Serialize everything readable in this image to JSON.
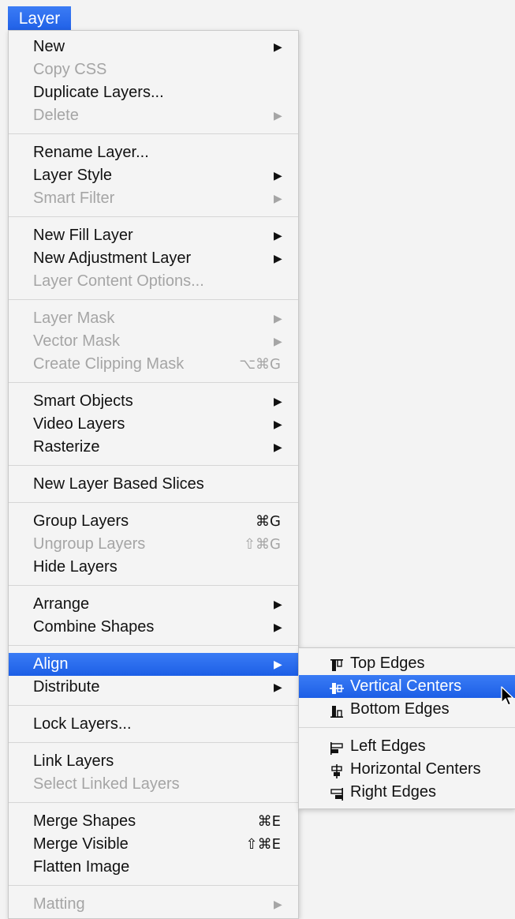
{
  "menubar": {
    "title": "Layer"
  },
  "menu": {
    "groups": [
      [
        {
          "label": "New",
          "submenu": true
        },
        {
          "label": "Copy CSS",
          "disabled": true
        },
        {
          "label": "Duplicate Layers..."
        },
        {
          "label": "Delete",
          "submenu": true,
          "disabled": true
        }
      ],
      [
        {
          "label": "Rename Layer..."
        },
        {
          "label": "Layer Style",
          "submenu": true
        },
        {
          "label": "Smart Filter",
          "submenu": true,
          "disabled": true
        }
      ],
      [
        {
          "label": "New Fill Layer",
          "submenu": true
        },
        {
          "label": "New Adjustment Layer",
          "submenu": true
        },
        {
          "label": "Layer Content Options...",
          "disabled": true
        }
      ],
      [
        {
          "label": "Layer Mask",
          "submenu": true,
          "disabled": true
        },
        {
          "label": "Vector Mask",
          "submenu": true,
          "disabled": true
        },
        {
          "label": "Create Clipping Mask",
          "shortcut": "⌥⌘G",
          "disabled": true
        }
      ],
      [
        {
          "label": "Smart Objects",
          "submenu": true
        },
        {
          "label": "Video Layers",
          "submenu": true
        },
        {
          "label": "Rasterize",
          "submenu": true
        }
      ],
      [
        {
          "label": "New Layer Based Slices"
        }
      ],
      [
        {
          "label": "Group Layers",
          "shortcut": "⌘G"
        },
        {
          "label": "Ungroup Layers",
          "shortcut": "⇧⌘G",
          "disabled": true
        },
        {
          "label": "Hide Layers"
        }
      ],
      [
        {
          "label": "Arrange",
          "submenu": true
        },
        {
          "label": "Combine Shapes",
          "submenu": true
        }
      ],
      [
        {
          "label": "Align",
          "submenu": true,
          "highlighted": true
        },
        {
          "label": "Distribute",
          "submenu": true
        }
      ],
      [
        {
          "label": "Lock Layers..."
        }
      ],
      [
        {
          "label": "Link Layers"
        },
        {
          "label": "Select Linked Layers",
          "disabled": true
        }
      ],
      [
        {
          "label": "Merge Shapes",
          "shortcut": "⌘E"
        },
        {
          "label": "Merge Visible",
          "shortcut": "⇧⌘E"
        },
        {
          "label": "Flatten Image"
        }
      ],
      [
        {
          "label": "Matting",
          "submenu": true,
          "disabled": true
        }
      ]
    ]
  },
  "submenu_arrow": "▶",
  "align_submenu": {
    "groups": [
      [
        {
          "label": "Top Edges",
          "icon": "align-top-edges-icon"
        },
        {
          "label": "Vertical Centers",
          "icon": "align-vertical-centers-icon",
          "highlighted": true
        },
        {
          "label": "Bottom Edges",
          "icon": "align-bottom-edges-icon"
        }
      ],
      [
        {
          "label": "Left Edges",
          "icon": "align-left-edges-icon"
        },
        {
          "label": "Horizontal Centers",
          "icon": "align-horizontal-centers-icon"
        },
        {
          "label": "Right Edges",
          "icon": "align-right-edges-icon"
        }
      ]
    ]
  },
  "colors": {
    "highlight": "#2366ea",
    "disabled_text": "#a5a5a5",
    "menu_bg": "#f4f4f4"
  }
}
